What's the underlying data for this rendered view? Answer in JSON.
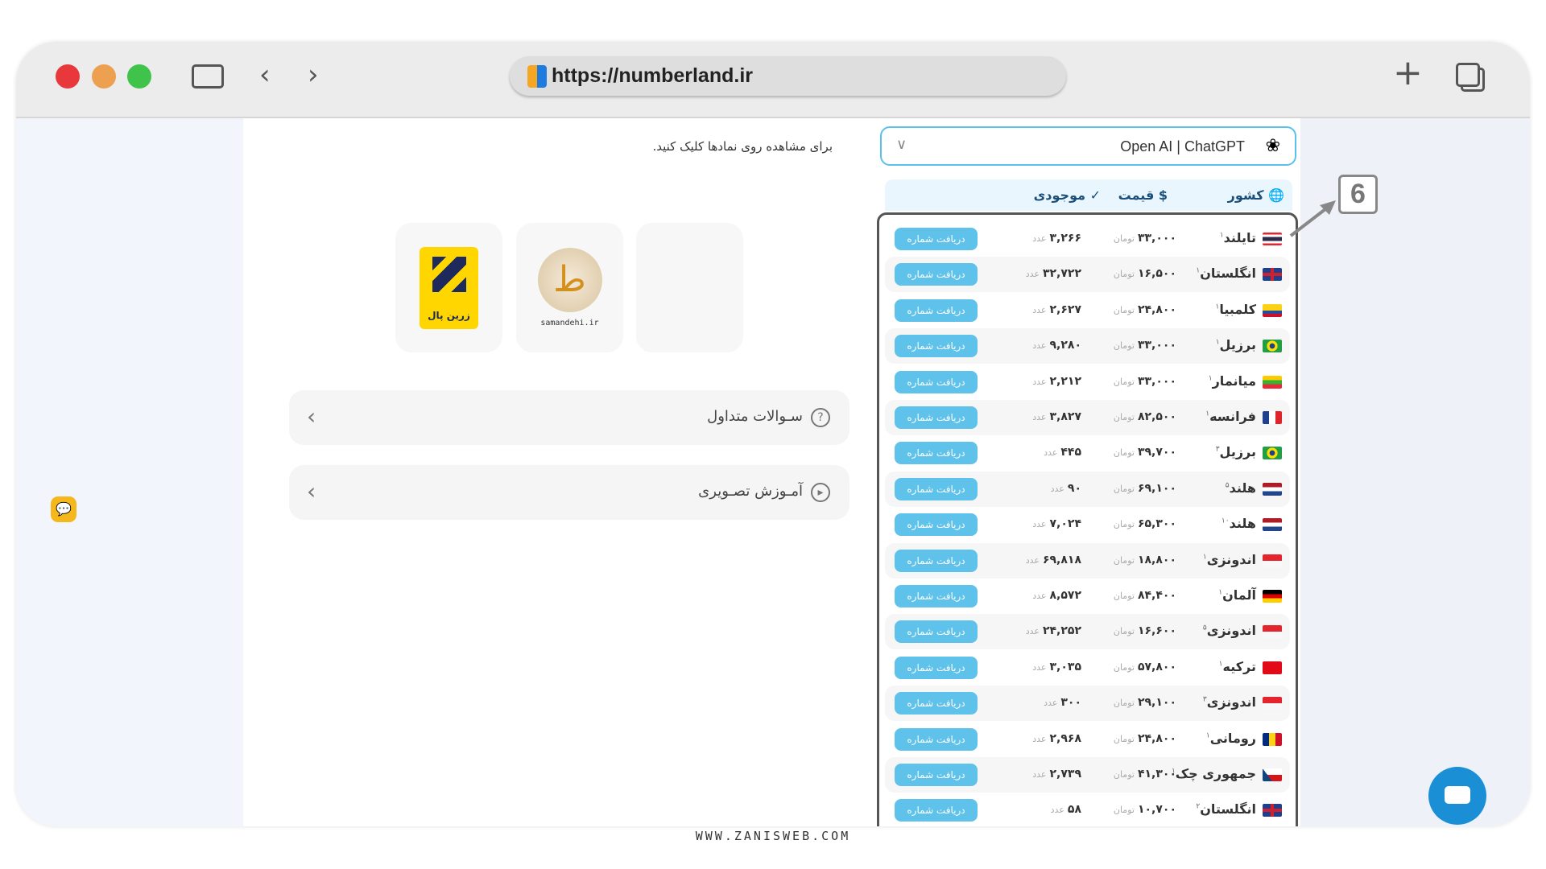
{
  "browser": {
    "url": "https://numberland.ir"
  },
  "colors": {
    "accent": "#5ec2ea",
    "header_bg": "#eaf6fd",
    "chat": "#1a8fd6"
  },
  "left": {
    "note": "برای مشاهده روی نمادها کلیک کنید.",
    "badges": [
      {
        "name": "zarinpal",
        "text": "زرین پال"
      },
      {
        "name": "samandehi",
        "text": "samandehi.ir"
      },
      {
        "name": "empty",
        "text": ""
      }
    ],
    "accordions": [
      {
        "label": "سـوالات متداول",
        "icon": "question-icon"
      },
      {
        "label": "آمـوزش تصـویری",
        "icon": "play-icon"
      }
    ]
  },
  "service": {
    "selected": "Open AI | ChatGPT"
  },
  "table": {
    "headers": {
      "country": "کشور",
      "price": "قیمت",
      "stock": "موجودی"
    },
    "price_unit": "تومان",
    "stock_unit": "عدد",
    "button_label": "دریافت شماره",
    "rows": [
      {
        "flag": "thailand",
        "country": "تایلند",
        "sup": "۱",
        "price": "۳۳,۰۰۰",
        "stock": "۳,۲۶۶"
      },
      {
        "flag": "uk",
        "country": "انگلستان",
        "sup": "۱",
        "price": "۱۶,۵۰۰",
        "stock": "۳۲,۷۲۲"
      },
      {
        "flag": "colombia",
        "country": "کلمبیا",
        "sup": "۱",
        "price": "۲۴,۸۰۰",
        "stock": "۲,۶۲۷"
      },
      {
        "flag": "brazil",
        "country": "برزیل",
        "sup": "۱",
        "price": "۳۳,۰۰۰",
        "stock": "۹,۲۸۰"
      },
      {
        "flag": "myanmar",
        "country": "میانمار",
        "sup": "۱",
        "price": "۳۳,۰۰۰",
        "stock": "۲,۲۱۲"
      },
      {
        "flag": "france",
        "country": "فرانسه",
        "sup": "۱",
        "price": "۸۲,۵۰۰",
        "stock": "۳,۸۲۷"
      },
      {
        "flag": "brazil",
        "country": "برزیل",
        "sup": "۳",
        "price": "۳۹,۷۰۰",
        "stock": "۴۴۵"
      },
      {
        "flag": "netherlands",
        "country": "هلند",
        "sup": "۵",
        "price": "۶۹,۱۰۰",
        "stock": "۹۰"
      },
      {
        "flag": "netherlands",
        "country": "هلند",
        "sup": "۱۰",
        "price": "۶۵,۳۰۰",
        "stock": "۷,۰۲۴"
      },
      {
        "flag": "indonesia",
        "country": "اندونزی",
        "sup": "۱",
        "price": "۱۸,۸۰۰",
        "stock": "۶۹,۸۱۸"
      },
      {
        "flag": "germany",
        "country": "آلمان",
        "sup": "۱",
        "price": "۸۴,۴۰۰",
        "stock": "۸,۵۷۲"
      },
      {
        "flag": "indonesia",
        "country": "اندونزی",
        "sup": "۵",
        "price": "۱۶,۶۰۰",
        "stock": "۲۴,۲۵۲"
      },
      {
        "flag": "turkey",
        "country": "ترکیه",
        "sup": "۱",
        "price": "۵۷,۸۰۰",
        "stock": "۳,۰۳۵"
      },
      {
        "flag": "indonesia",
        "country": "اندونزی",
        "sup": "۳",
        "price": "۲۹,۱۰۰",
        "stock": "۳۰۰"
      },
      {
        "flag": "romania",
        "country": "رومانی",
        "sup": "۱",
        "price": "۲۴,۸۰۰",
        "stock": "۲,۹۶۸"
      },
      {
        "flag": "czech",
        "country": "جمهوری چک",
        "sup": "۱",
        "price": "۴۱,۳۰۰",
        "stock": "۲,۷۳۹"
      },
      {
        "flag": "uk",
        "country": "انگلستان",
        "sup": "۲",
        "price": "۱۰,۷۰۰",
        "stock": "۵۸"
      }
    ]
  },
  "annotation": {
    "step": "6"
  },
  "watermark": "WWW.ZANISWEB.COM"
}
